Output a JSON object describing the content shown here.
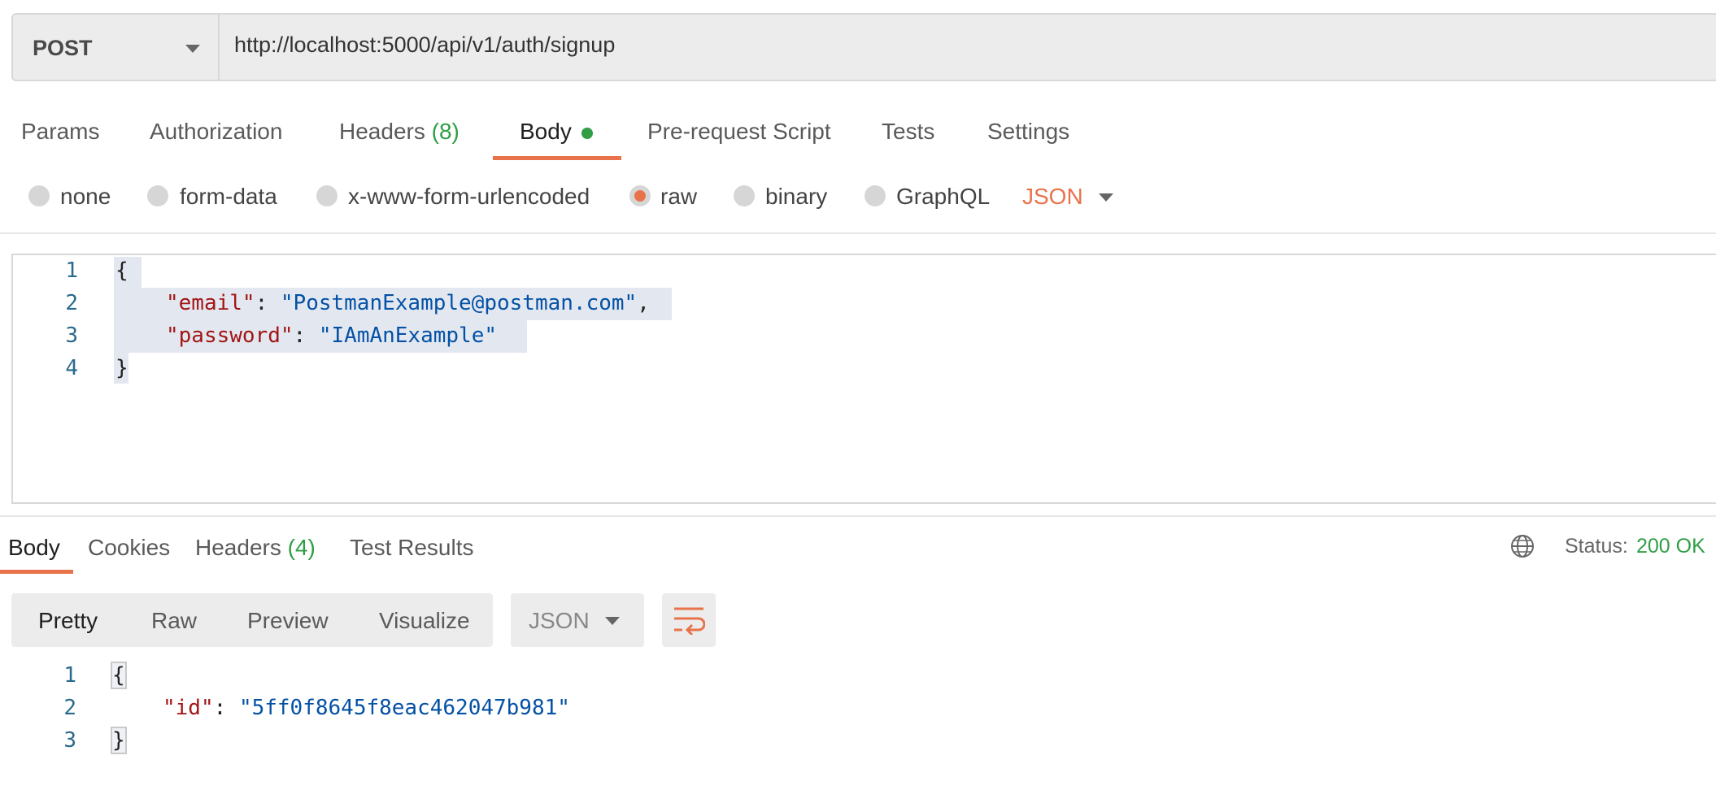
{
  "request": {
    "method": "POST",
    "url": "http://localhost:5000/api/v1/auth/signup"
  },
  "request_tabs": {
    "params": "Params",
    "authorization": "Authorization",
    "headers": "Headers",
    "headers_count": "(8)",
    "body": "Body",
    "pre_request": "Pre-request Script",
    "tests": "Tests",
    "settings": "Settings"
  },
  "body_types": {
    "none": "none",
    "form_data": "form-data",
    "urlencoded": "x-www-form-urlencoded",
    "raw": "raw",
    "binary": "binary",
    "graphql": "GraphQL",
    "selected": "raw",
    "format": "JSON"
  },
  "request_body": {
    "line_numbers": [
      "1",
      "2",
      "3",
      "4"
    ],
    "open_brace": "{",
    "close_brace": "}",
    "email_key": "\"email\"",
    "email_value": "\"PostmanExample@postman.com\"",
    "password_key": "\"password\"",
    "password_value": "\"IAmAnExample\""
  },
  "response_tabs": {
    "body": "Body",
    "cookies": "Cookies",
    "headers": "Headers",
    "headers_count": "(4)",
    "test_results": "Test Results"
  },
  "status": {
    "label": "Status:",
    "value": "200 OK"
  },
  "response_view": {
    "pretty": "Pretty",
    "raw": "Raw",
    "preview": "Preview",
    "visualize": "Visualize",
    "format": "JSON"
  },
  "response_body": {
    "line_numbers": [
      "1",
      "2",
      "3"
    ],
    "open_brace": "{",
    "close_brace": "}",
    "id_key": "\"id\"",
    "id_value": "\"5ff0f8645f8eac462047b981\""
  },
  "colors": {
    "accent": "#e8734a",
    "success": "#2f9e44",
    "json_key": "#a31515",
    "json_string": "#0451a5"
  }
}
